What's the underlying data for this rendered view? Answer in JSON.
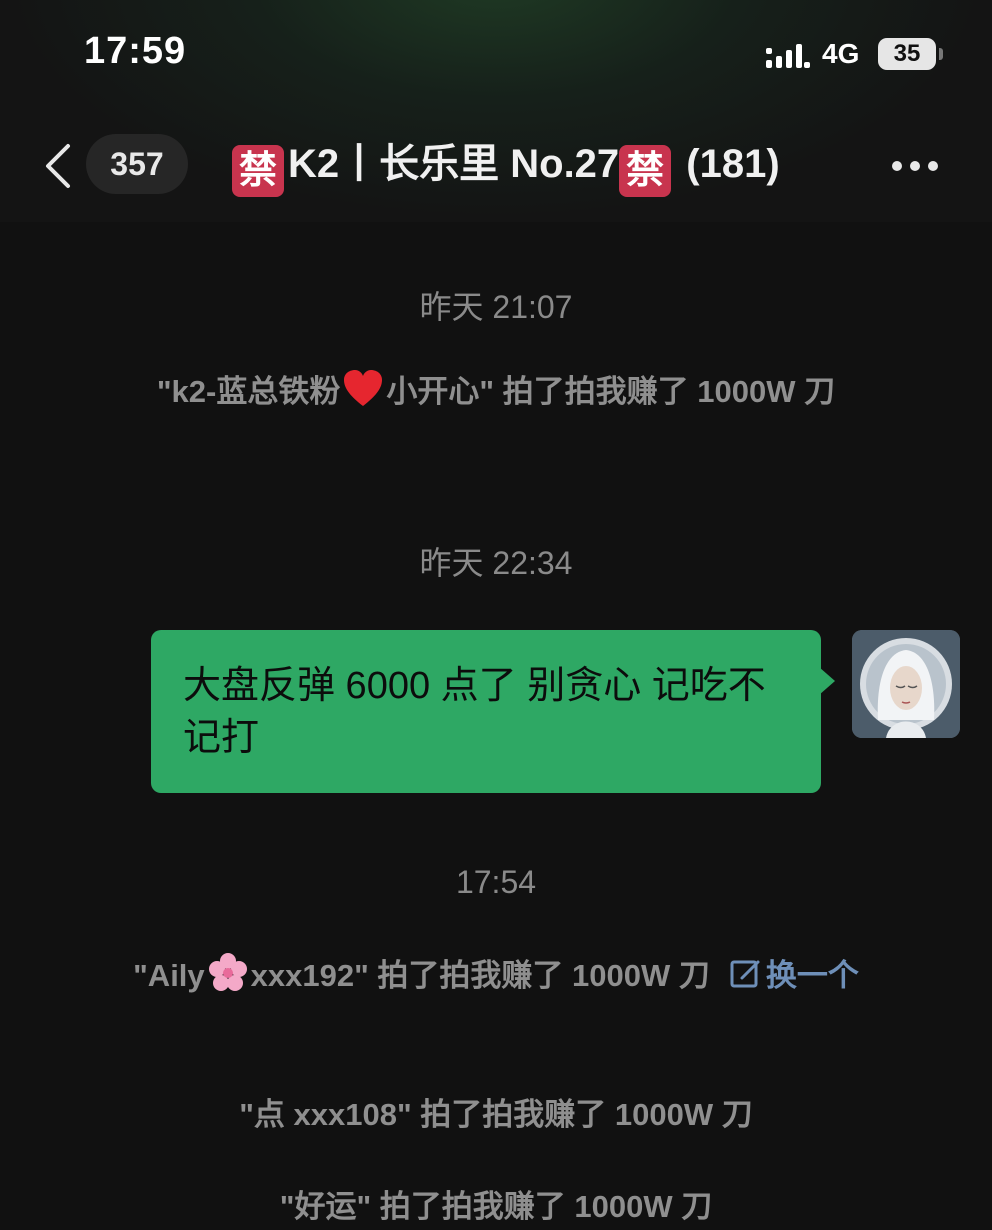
{
  "status_bar": {
    "time": "17:59",
    "network": "4G",
    "battery": "35"
  },
  "nav": {
    "unread_count": "357",
    "title_prefix": "K2丨长乐里 No.27",
    "member_count": "(181)",
    "forbid_glyph": "禁"
  },
  "messages": [
    {
      "type": "timestamp",
      "text": "昨天 21:07"
    },
    {
      "type": "system",
      "before": "\"k2-蓝总铁粉",
      "after": "小开心\" 拍了拍我赚了 1000W 刀",
      "icon": "heart-icon"
    },
    {
      "type": "timestamp",
      "text": "昨天 22:34"
    },
    {
      "type": "bubble",
      "text": "大盘反弹 6000 点了 别贪心  记吃不记打",
      "sender": "me"
    },
    {
      "type": "timestamp",
      "text": "17:54"
    },
    {
      "type": "system",
      "before": "\"Aily",
      "after": "xxx192\" 拍了拍我赚了 1000W 刀",
      "icon": "cherry-blossom-icon",
      "edit_label": "换一个"
    },
    {
      "type": "system",
      "text": "\"点 xxx108\" 拍了拍我赚了 1000W 刀"
    },
    {
      "type": "system",
      "text": "\"好运\" 拍了拍我赚了 1000W 刀"
    }
  ],
  "colors": {
    "bubble": "#2ea864",
    "badge_forbid": "#c8344e",
    "link": "#6e8fb8",
    "system_text": "#8f8f8f"
  }
}
